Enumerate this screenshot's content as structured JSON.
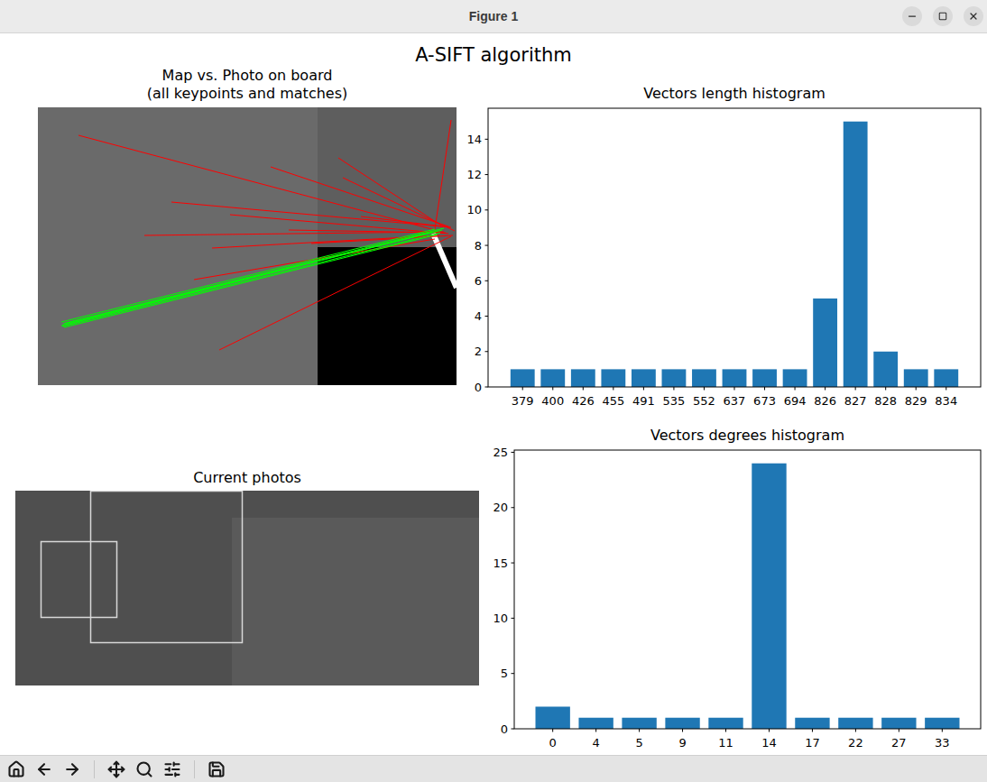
{
  "window": {
    "title": "Figure 1"
  },
  "figure": {
    "title": "A-SIFT algorithm"
  },
  "match_panel": {
    "title_lines": [
      "Map vs. Photo on board",
      "(all keypoints and matches)"
    ],
    "matches": [
      {
        "from": [
          45,
          31
        ],
        "to": [
          440,
          136
        ],
        "inlier": false
      },
      {
        "from": [
          148,
          105
        ],
        "to": [
          458,
          133
        ],
        "inlier": false
      },
      {
        "from": [
          118,
          142
        ],
        "to": [
          450,
          138
        ],
        "inlier": false
      },
      {
        "from": [
          213,
          119
        ],
        "to": [
          455,
          140
        ],
        "inlier": false
      },
      {
        "from": [
          193,
          156
        ],
        "to": [
          445,
          142
        ],
        "inlier": false
      },
      {
        "from": [
          173,
          191
        ],
        "to": [
          440,
          146
        ],
        "inlier": false
      },
      {
        "from": [
          201,
          269
        ],
        "to": [
          458,
          143
        ],
        "inlier": false
      },
      {
        "from": [
          258,
          66
        ],
        "to": [
          455,
          132
        ],
        "inlier": false
      },
      {
        "from": [
          338,
          78
        ],
        "to": [
          462,
          137
        ],
        "inlier": false
      },
      {
        "from": [
          333,
          56
        ],
        "to": [
          447,
          131
        ],
        "inlier": false
      },
      {
        "from": [
          458,
          14
        ],
        "to": [
          440,
          135
        ],
        "inlier": false
      },
      {
        "from": [
          303,
          151
        ],
        "to": [
          460,
          142
        ],
        "inlier": false
      },
      {
        "from": [
          278,
          136
        ],
        "to": [
          452,
          139
        ],
        "inlier": false
      },
      {
        "from": [
          358,
          121
        ],
        "to": [
          457,
          133
        ],
        "inlier": false
      },
      {
        "from": [
          26,
          238
        ],
        "to": [
          440,
          135
        ],
        "inlier": true
      },
      {
        "from": [
          28,
          240
        ],
        "to": [
          444,
          137
        ],
        "inlier": true
      },
      {
        "from": [
          27,
          243
        ],
        "to": [
          446,
          139
        ],
        "inlier": true
      },
      {
        "from": [
          30,
          241
        ],
        "to": [
          448,
          136
        ],
        "inlier": true
      },
      {
        "from": [
          29,
          244
        ],
        "to": [
          443,
          141
        ],
        "inlier": true
      },
      {
        "from": [
          31,
          239
        ],
        "to": [
          450,
          134
        ],
        "inlier": true
      },
      {
        "from": [
          26,
          242
        ],
        "to": [
          438,
          138
        ],
        "inlier": true
      }
    ]
  },
  "photos_panel": {
    "title": "Current photos",
    "frames": [
      {
        "x": 28,
        "y": 56,
        "w": 84,
        "h": 84
      },
      {
        "x": 83,
        "y": 0,
        "w": 168,
        "h": 168
      }
    ]
  },
  "charts": [
    {
      "title": "Vectors length histogram",
      "categories": [
        "379",
        "400",
        "426",
        "455",
        "491",
        "535",
        "552",
        "637",
        "673",
        "694",
        "826",
        "827",
        "828",
        "829",
        "834"
      ],
      "values": [
        1,
        1,
        1,
        1,
        1,
        1,
        1,
        1,
        1,
        1,
        5,
        15,
        2,
        1,
        1
      ],
      "y_ticks": [
        "0",
        "2",
        "4",
        "6",
        "8",
        "10",
        "12",
        "14"
      ]
    },
    {
      "title": "Vectors degrees histogram",
      "categories": [
        "0",
        "4",
        "5",
        "9",
        "11",
        "14",
        "17",
        "22",
        "27",
        "33"
      ],
      "values": [
        2,
        1,
        1,
        1,
        1,
        24,
        1,
        1,
        1,
        1
      ],
      "y_ticks": [
        "0",
        "5",
        "10",
        "15",
        "20",
        "25"
      ]
    }
  ]
}
